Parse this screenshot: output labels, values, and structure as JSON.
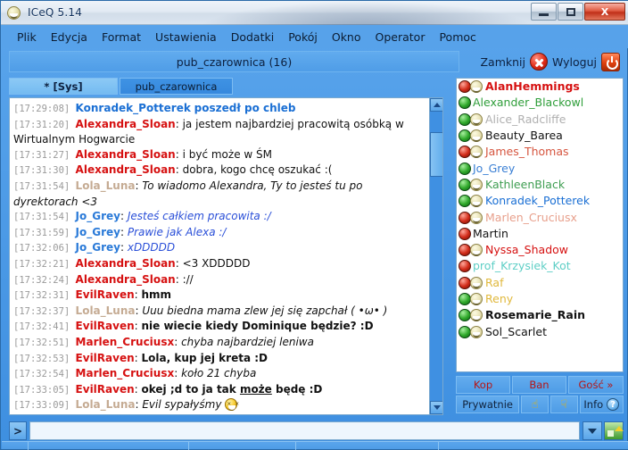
{
  "window": {
    "app_title": "ICeQ 5.14",
    "minimize_label": "–",
    "maximize_label": "□",
    "close_label": "X"
  },
  "menubar": {
    "items": [
      {
        "label": "Plik"
      },
      {
        "label": "Edycja"
      },
      {
        "label": "Format"
      },
      {
        "label": "Ustawienia"
      },
      {
        "label": "Dodatki"
      },
      {
        "label": "Pokój"
      },
      {
        "label": "Okno"
      },
      {
        "label": "Operator"
      },
      {
        "label": "Pomoc"
      }
    ]
  },
  "room_header": {
    "title": "pub_czarownica (16)"
  },
  "session": {
    "close_label": "Zamknij",
    "logout_label": "Wyloguj"
  },
  "tabs": [
    {
      "label": "*  [Sys]",
      "active": false
    },
    {
      "label": "pub_czarownica",
      "active": true
    }
  ],
  "chat": {
    "messages": [
      {
        "ts": "[17:29:08]",
        "nick": "Konradek_Potterek",
        "nick_color": "#1a6fd4",
        "sep": " ",
        "body": "poszedł po chleb",
        "style": "bold",
        "body_color": "#1a6fd4"
      },
      {
        "ts": "[17:31:20]",
        "nick": "Alexandra_Sloan",
        "nick_color": "#d61111",
        "sep": ": ",
        "body": "ja jestem najbardziej pracowitą osóbką w Wirtualnym Hogwarcie",
        "style": "plain",
        "body_color": "#111111"
      },
      {
        "ts": "[17:31:27]",
        "nick": "Alexandra_Sloan",
        "nick_color": "#d61111",
        "sep": ": ",
        "body": "i być może w ŚM",
        "style": "plain",
        "body_color": "#111111"
      },
      {
        "ts": "[17:31:30]",
        "nick": "Alexandra_Sloan",
        "nick_color": "#d61111",
        "sep": ": ",
        "body": "dobra, kogo chcę oszukać :(",
        "style": "plain",
        "body_color": "#111111"
      },
      {
        "ts": "[17:31:54]",
        "nick": "Lola_Luna",
        "nick_color": "#c5ab93",
        "sep": ": ",
        "body": "To wiadomo Alexandra, Ty to jesteś tu po dyrektorach <3",
        "style": "italic",
        "body_color": "#111111"
      },
      {
        "ts": "[17:31:54]",
        "nick": "Jo_Grey",
        "nick_color": "#2a7ad8",
        "sep": ":  ",
        "body": "Jesteś całkiem pracowita :/",
        "style": "italic",
        "body_color": "#2a4fd8"
      },
      {
        "ts": "[17:31:59]",
        "nick": "Jo_Grey",
        "nick_color": "#2a7ad8",
        "sep": ":  ",
        "body": "Prawie jak Alexa :/",
        "style": "italic",
        "body_color": "#2a4fd8"
      },
      {
        "ts": "[17:32:06]",
        "nick": "Jo_Grey",
        "nick_color": "#2a7ad8",
        "sep": ":  ",
        "body": "xDDDDD",
        "style": "italic",
        "body_color": "#2a4fd8"
      },
      {
        "ts": "[17:32:21]",
        "nick": "Alexandra_Sloan",
        "nick_color": "#d61111",
        "sep": ": ",
        "body": "<3 XDDDDD",
        "style": "plain",
        "body_color": "#111111"
      },
      {
        "ts": "[17:32:24]",
        "nick": "Alexandra_Sloan",
        "nick_color": "#d61111",
        "sep": ": ",
        "body": "://",
        "style": "plain",
        "body_color": "#111111"
      },
      {
        "ts": "[17:32:31]",
        "nick": "EvilRaven",
        "nick_color": "#d61111",
        "sep": ": ",
        "body": "hmm",
        "style": "bold",
        "body_color": "#111111"
      },
      {
        "ts": "[17:32:37]",
        "nick": "Lola_Luna",
        "nick_color": "#c5ab93",
        "sep": ": ",
        "body": "Uuu biedna mama zlew jej się zapchał ( •ω• )",
        "style": "italic",
        "body_color": "#111111"
      },
      {
        "ts": "[17:32:41]",
        "nick": "EvilRaven",
        "nick_color": "#d61111",
        "sep": ": ",
        "body": "nie wiecie kiedy Dominique będzie? :D",
        "style": "bold",
        "body_color": "#111111"
      },
      {
        "ts": "[17:32:51]",
        "nick": "Marlen_Cruciusx",
        "nick_color": "#d61111",
        "sep": ": ",
        "body": "chyba najbardziej leniwa",
        "style": "italic",
        "body_color": "#111111"
      },
      {
        "ts": "[17:32:53]",
        "nick": "EvilRaven",
        "nick_color": "#d61111",
        "sep": ": ",
        "body": "Lola, kup jej kreta :D",
        "style": "bold",
        "body_color": "#111111"
      },
      {
        "ts": "[17:32:54]",
        "nick": "Marlen_Cruciusx",
        "nick_color": "#d61111",
        "sep": ": ",
        "body": "koło 21 chyba",
        "style": "italic",
        "body_color": "#111111"
      },
      {
        "ts": "[17:33:05]",
        "nick": "EvilRaven",
        "nick_color": "#d61111",
        "sep": ": ",
        "body": "okej ;d to ja tak może będę :D",
        "style": "bold",
        "body_color": "#111111",
        "underline_word": "może"
      },
      {
        "ts": "[17:33:09]",
        "nick": "Lola_Luna",
        "nick_color": "#c5ab93",
        "sep": ": ",
        "body": "Evil sypałyśmy",
        "style": "italic",
        "body_color": "#111111",
        "emoji": "laughing-emoji"
      }
    ]
  },
  "userlist": {
    "users": [
      {
        "name": "AlanHemmings",
        "ball": "red",
        "face": true,
        "color": "#d61111",
        "bold": true
      },
      {
        "name": "Alexander_Blackowl",
        "ball": "green",
        "face": false,
        "color": "#2f9e3a",
        "bold": false
      },
      {
        "name": "Alice_Radcliffe",
        "ball": "green",
        "face": true,
        "color": "#b0b0b0",
        "bold": false
      },
      {
        "name": "Beauty_Barea",
        "ball": "green",
        "face": true,
        "color": "#111111",
        "bold": false
      },
      {
        "name": "James_Thomas",
        "ball": "red",
        "face": true,
        "color": "#d6553f",
        "bold": false
      },
      {
        "name": "Jo_Grey",
        "ball": "green",
        "face": false,
        "color": "#3a7fd4",
        "bold": false
      },
      {
        "name": "KathleenBlack",
        "ball": "green",
        "face": true,
        "color": "#3f9e52",
        "bold": false
      },
      {
        "name": "Konradek_Potterek",
        "ball": "green",
        "face": true,
        "color": "#1a6fd4",
        "bold": false
      },
      {
        "name": "Marlen_Cruciusx",
        "ball": "red",
        "face": true,
        "color": "#e8a08c",
        "bold": false
      },
      {
        "name": "Martin",
        "ball": "red",
        "face": false,
        "color": "#111111",
        "bold": false
      },
      {
        "name": "Nyssa_Shadow",
        "ball": "red",
        "face": true,
        "color": "#d61111",
        "bold": false
      },
      {
        "name": "prof_Krzysiek_Kot",
        "ball": "red",
        "face": false,
        "color": "#5fcfc6",
        "bold": false
      },
      {
        "name": "Raf",
        "ball": "red",
        "face": true,
        "color": "#e0b83c",
        "bold": false
      },
      {
        "name": "Reny",
        "ball": "green",
        "face": true,
        "color": "#e0b83c",
        "bold": false
      },
      {
        "name": "Rosemarie_Rain",
        "ball": "green",
        "face": true,
        "color": "#111111",
        "bold": true
      },
      {
        "name": "Sol_Scarlet",
        "ball": "green",
        "face": true,
        "color": "#111111",
        "bold": false
      }
    ]
  },
  "actions": {
    "kop": "Kop",
    "ban": "Ban",
    "guest": "Gość »",
    "private": "Prywatnie",
    "thumbs_up": "☝",
    "thumbs_down": "☟",
    "info": "Info",
    "info_badge": "?"
  },
  "input": {
    "send_label": ">",
    "value": "",
    "placeholder": ""
  }
}
